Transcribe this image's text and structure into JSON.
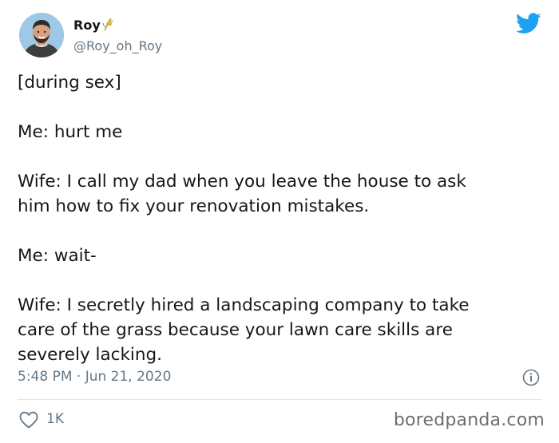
{
  "author": {
    "name": "Roy",
    "handle": "@Roy_oh_Roy",
    "name_emoji_icon": "wheat-icon"
  },
  "tweet": {
    "lines": [
      "[during sex]",
      "",
      "Me: hurt me",
      "",
      "Wife: I call my dad when you leave the house to ask",
      "him how to fix your renovation mistakes.",
      "",
      "Me: wait-",
      "",
      "Wife: I secretly hired a landscaping company to take",
      "care of the grass because your lawn care skills are",
      "severely lacking."
    ],
    "timestamp": "5:48 PM · Jun 21, 2020",
    "likes": "1K"
  },
  "watermark": "boredpanda.com",
  "colors": {
    "twitter_blue": "#1da1f2",
    "secondary_text": "#657786",
    "primary_text": "#14171a"
  },
  "icons": [
    "twitter-logo-icon",
    "info-icon",
    "heart-icon",
    "wheat-icon"
  ]
}
